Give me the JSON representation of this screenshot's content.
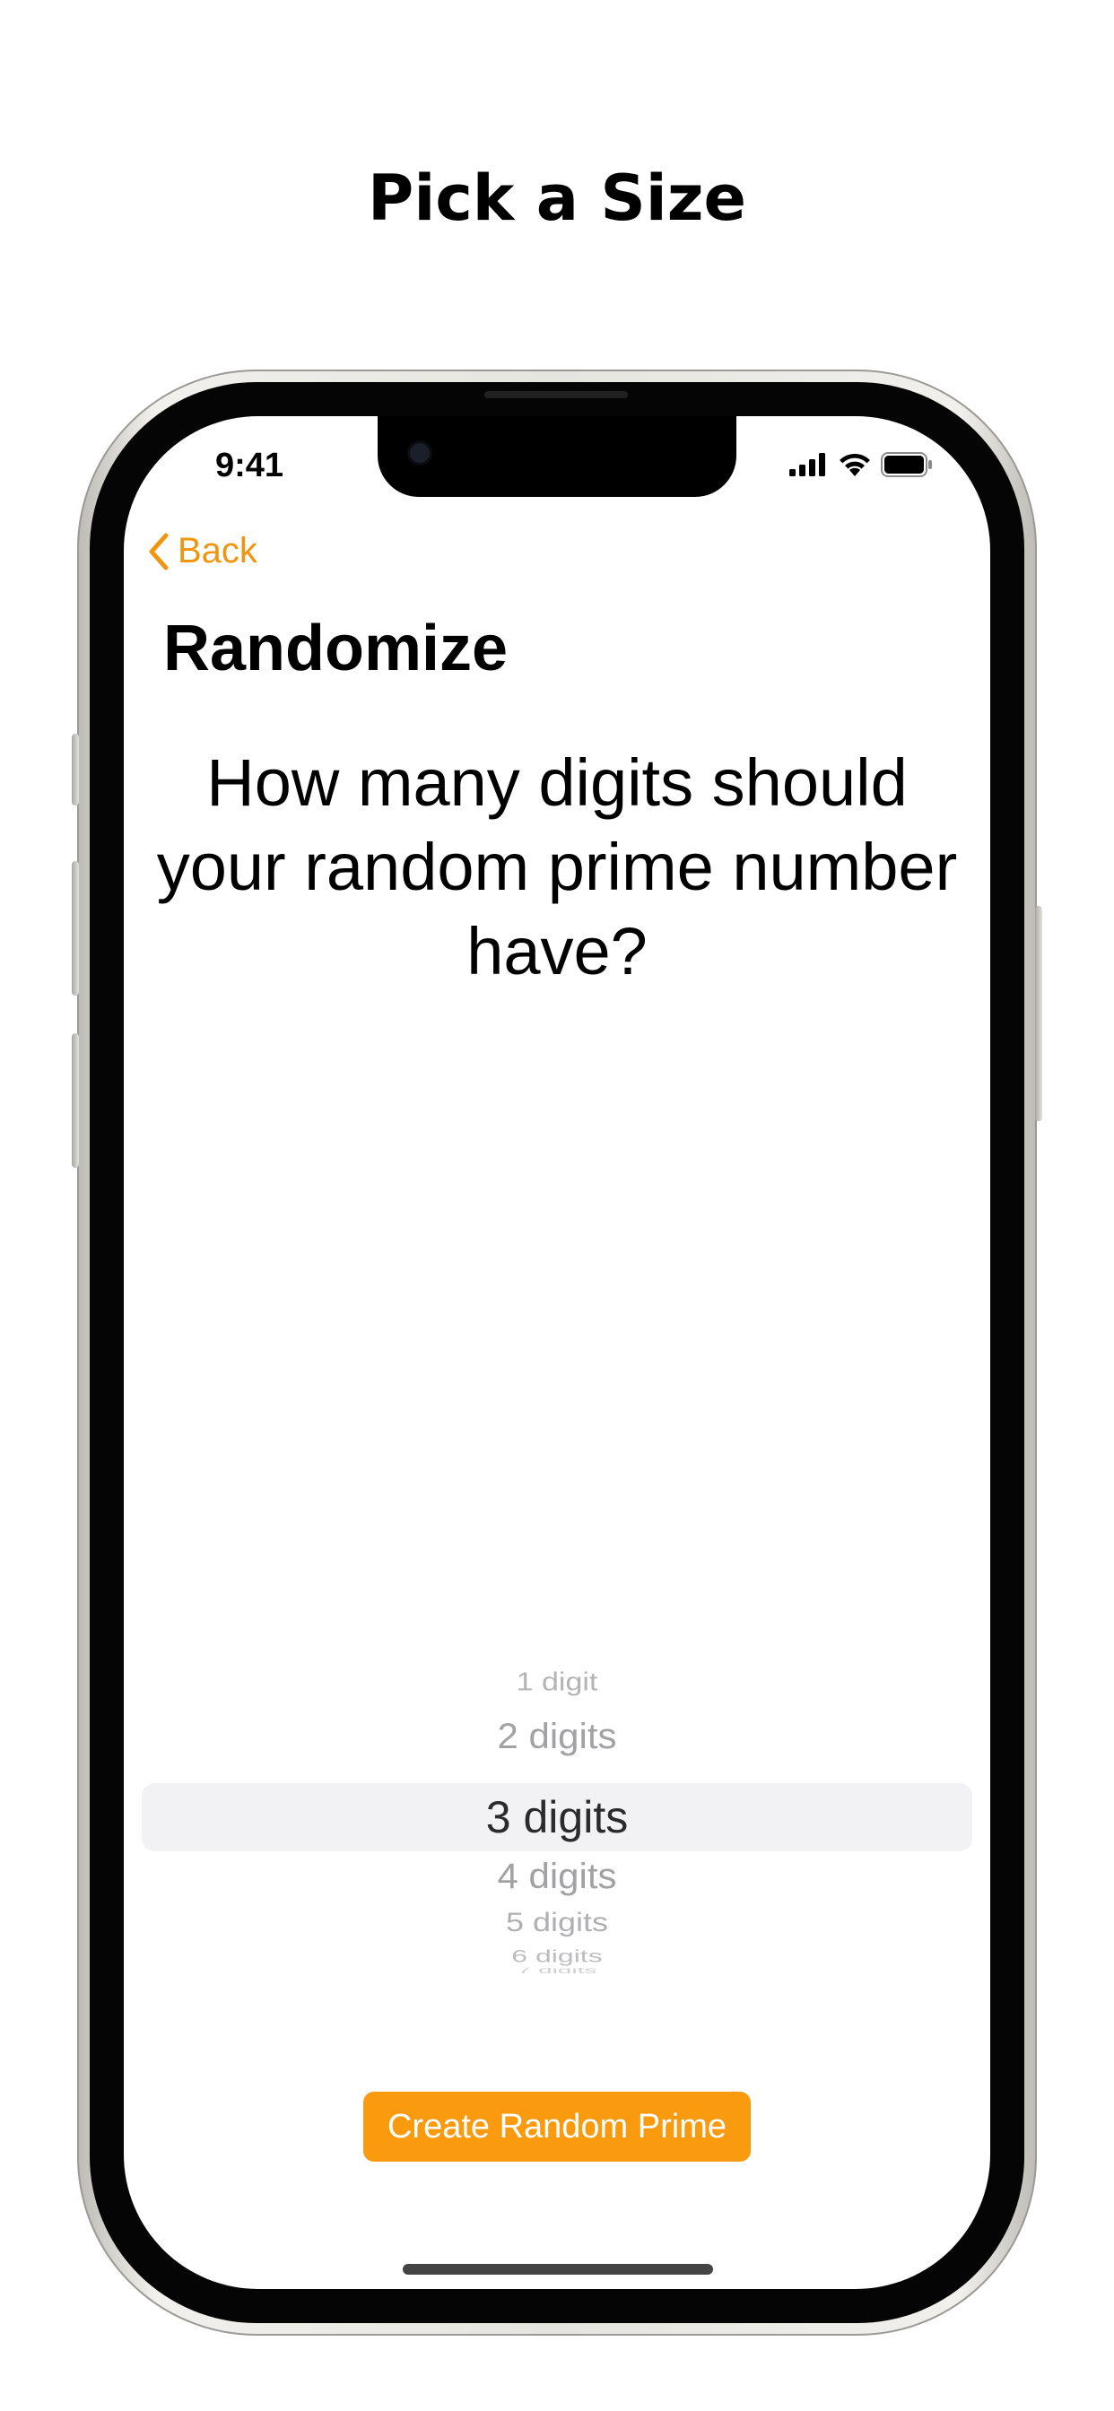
{
  "page": {
    "headline": "Pick a Size"
  },
  "status_bar": {
    "time": "9:41",
    "icons": [
      "cellular-signal-icon",
      "wifi-icon",
      "battery-icon"
    ]
  },
  "nav": {
    "back_label": "Back",
    "title": "Randomize"
  },
  "content": {
    "question_lines": [
      "How many digits should",
      "your random prime number",
      "have?"
    ]
  },
  "picker": {
    "options": [
      "1 digit",
      "2 digits",
      "3 digits",
      "4 digits",
      "5 digits",
      "6 digits",
      "7 digits"
    ],
    "selected": "3 digits"
  },
  "actions": {
    "create_label": "Create Random Prime"
  },
  "colors": {
    "accent": "#F99A0F",
    "back_tint": "#F0950F",
    "picker_selection": "#F2F2F4",
    "picker_dim_text": "#A5A5A8"
  }
}
